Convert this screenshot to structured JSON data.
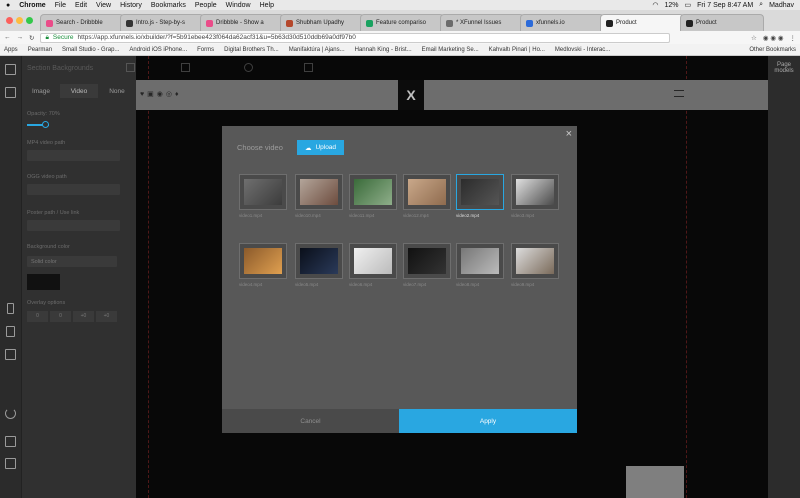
{
  "menubar": {
    "apple": "",
    "app": "Chrome",
    "items": [
      "File",
      "Edit",
      "View",
      "History",
      "Bookmarks",
      "People",
      "Window",
      "Help"
    ],
    "battery": "12%",
    "clock": "Fri 7 Sep  8:47 AM",
    "user": "Madhav"
  },
  "tabs": [
    {
      "label": "Search - Dribbble",
      "color": "#ea4c89"
    },
    {
      "label": "Intro.js - Step-by-s",
      "color": "#333"
    },
    {
      "label": "Dribbble - Show a",
      "color": "#ea4c89"
    },
    {
      "label": "Shubham Upadhy",
      "color": "#b5482c"
    },
    {
      "label": "Feature compariso",
      "color": "#1aa260"
    },
    {
      "label": "* XFunnel Issues",
      "color": "#6b6b6b"
    },
    {
      "label": "xfunnels.io",
      "color": "#2b6ad9"
    },
    {
      "label": "Product",
      "color": "#222"
    },
    {
      "label": "Product",
      "color": "#222"
    }
  ],
  "address": {
    "secure": "Secure",
    "url": "https://app.xfunnels.io/xbuilder/?f=5b91ebee423f064da62acf31&u=5b63d30d510ddb69a0df97b0"
  },
  "bookmarks": [
    "Apps",
    "Pearman",
    "Small Studio - Grap...",
    "Android iOS iPhone...",
    "Forms",
    "Digital Brothers Th...",
    "Manifaktúra | Ajans...",
    "Hannah King - Brist...",
    "Email Marketing Se...",
    "Kahvaltı Pinari | Ho...",
    "Medlovski - Interac..."
  ],
  "bookmarks_other": "Other Bookmarks",
  "panel": {
    "header": "Section Backgrounds",
    "tabs": [
      "Image",
      "Video",
      "None"
    ],
    "active_tab": "Video",
    "labels": [
      "Opacity: 70%",
      "MP4 video path",
      "OGG video path",
      "Poster path / Use link",
      "Background color"
    ],
    "select_value": "Solid color",
    "overlay_label": "Overlay options",
    "overlay_values": [
      "0",
      "0",
      "+0",
      "+0"
    ]
  },
  "right_panel": {
    "text": "Page models"
  },
  "modal": {
    "title": "Choose video",
    "upload": "Upload",
    "cancel": "Cancel",
    "apply": "Apply",
    "videos": [
      {
        "name": "video1.mp4",
        "colors": [
          "#6f6f6f",
          "#3c3c3c"
        ]
      },
      {
        "name": "video10.mp4",
        "colors": [
          "#b3a59a",
          "#6d4c3e"
        ]
      },
      {
        "name": "video11.mp4",
        "colors": [
          "#3a6b3a",
          "#8fae8a"
        ]
      },
      {
        "name": "video12.mp4",
        "colors": [
          "#c9a88a",
          "#8f6b4e"
        ]
      },
      {
        "name": "video2.mp4",
        "colors": [
          "#2c2c2c",
          "#555"
        ],
        "selected": true
      },
      {
        "name": "video3.mp4",
        "colors": [
          "#e0e0e0",
          "#4a4a4a"
        ]
      },
      {
        "name": "video4.mp4",
        "colors": [
          "#8b5a2b",
          "#e0a050"
        ]
      },
      {
        "name": "video5.mp4",
        "colors": [
          "#0a0f1a",
          "#2a3a5a"
        ]
      },
      {
        "name": "video6.mp4",
        "colors": [
          "#f0f0f0",
          "#bbb"
        ]
      },
      {
        "name": "video7.mp4",
        "colors": [
          "#111",
          "#333"
        ]
      },
      {
        "name": "video8.mp4",
        "colors": [
          "#777",
          "#bbb"
        ]
      },
      {
        "name": "video9.mp4",
        "colors": [
          "#dcdcdc",
          "#7a6a5a"
        ]
      }
    ]
  }
}
